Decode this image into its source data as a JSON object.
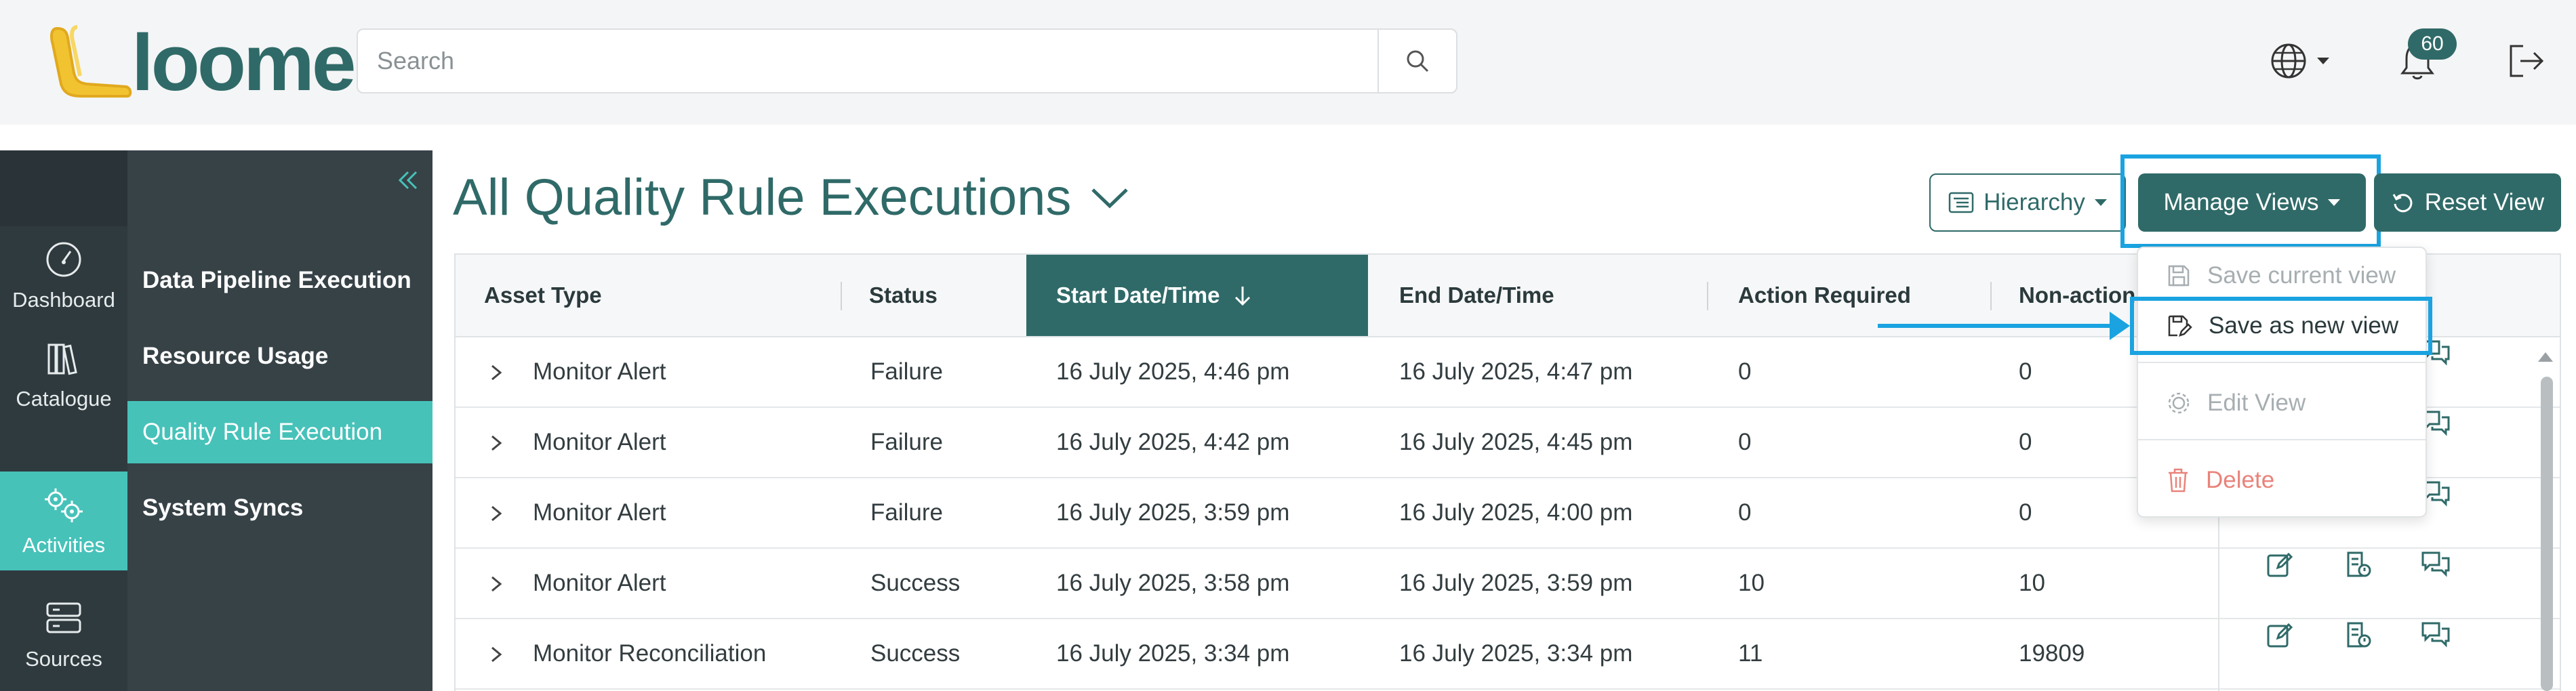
{
  "header": {
    "logo_text": "loome",
    "search": {
      "placeholder": "Search",
      "value": ""
    },
    "notification_count": "60"
  },
  "rail": {
    "items": [
      {
        "label": "Dashboard",
        "icon": "gauge-icon",
        "active": false
      },
      {
        "label": "Catalogue",
        "icon": "books-icon",
        "active": false
      },
      {
        "label": "Activities",
        "icon": "gears-icon",
        "active": true
      },
      {
        "label": "Sources",
        "icon": "server-icon",
        "active": false
      }
    ]
  },
  "subnav": {
    "items": [
      {
        "label": "Data Pipeline Execution",
        "active": false
      },
      {
        "label": "Resource Usage",
        "active": false
      },
      {
        "label": "Quality Rule Execution",
        "active": true
      },
      {
        "label": "System Syncs",
        "active": false
      }
    ]
  },
  "main": {
    "title": "All Quality Rule Executions",
    "toolbar": {
      "hierarchy_label": "Hierarchy",
      "manage_views_label": "Manage Views",
      "reset_view_label": "Reset View"
    },
    "dropdown": {
      "save_current": "Save current view",
      "save_new": "Save as new view",
      "edit": "Edit View",
      "delete": "Delete"
    },
    "table": {
      "columns": [
        "Asset Type",
        "Status",
        "Start Date/Time",
        "End Date/Time",
        "Action Required",
        "Non-action"
      ],
      "sorted_column": "Start Date/Time",
      "rows": [
        {
          "asset_type": "Monitor Alert",
          "status": "Failure",
          "start": "16 July 2025, 4:46 pm",
          "end": "16 July 2025, 4:47 pm",
          "action_required": "0",
          "non_action": "0"
        },
        {
          "asset_type": "Monitor Alert",
          "status": "Failure",
          "start": "16 July 2025, 4:42 pm",
          "end": "16 July 2025, 4:45 pm",
          "action_required": "0",
          "non_action": "0"
        },
        {
          "asset_type": "Monitor Alert",
          "status": "Failure",
          "start": "16 July 2025, 3:59 pm",
          "end": "16 July 2025, 4:00 pm",
          "action_required": "0",
          "non_action": "0"
        },
        {
          "asset_type": "Monitor Alert",
          "status": "Success",
          "start": "16 July 2025, 3:58 pm",
          "end": "16 July 2025, 3:59 pm",
          "action_required": "10",
          "non_action": "10"
        },
        {
          "asset_type": "Monitor Reconciliation",
          "status": "Success",
          "start": "16 July 2025, 3:34 pm",
          "end": "16 July 2025, 3:34 pm",
          "action_required": "11",
          "non_action": "19809"
        }
      ]
    }
  },
  "colors": {
    "brand": "#2f6a68",
    "accent": "#46c2b9",
    "highlight": "#1aa3e0",
    "danger": "#e9837a"
  }
}
